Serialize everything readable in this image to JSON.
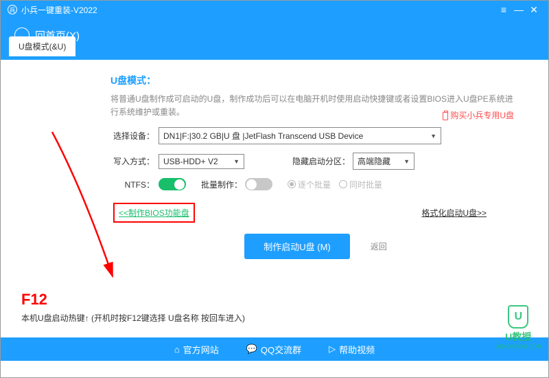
{
  "titlebar": {
    "app_name": "小兵一键重装-V2022"
  },
  "subheader": {
    "back_label": "回首页(X)"
  },
  "tab": {
    "label": "U盘模式(&U)"
  },
  "main": {
    "section_title": "U盘模式：",
    "description": "将普通U盘制作成可启动的U盘，制作成功后可以在电脑开机时使用启动快捷键或者设置BIOS进入U盘PE系统进行系统维护或重装。",
    "buy_link": "购买小兵专用U盘",
    "device_label": "选择设备：",
    "device_value": "DN1|F:|30.2 GB|U 盘 |JetFlash Transcend USB Device",
    "write_label": "写入方式：",
    "write_value": "USB-HDD+ V2",
    "hide_label": "隐藏启动分区：",
    "hide_value": "高端隐藏",
    "ntfs_label": "NTFS：",
    "batch_label": "批量制作：",
    "radio_each": "逐个批量",
    "radio_same": "同时批量",
    "bios_link": "<<制作BIOS功能盘",
    "format_link": "格式化启动U盘>>",
    "primary_button": "制作启动U盘 (M)",
    "back_text": "返回",
    "f12_label": "F12",
    "hotkey_text": "本机U盘启动热键↑ (开机时按F12键选择 U盘名称 按回车进入)"
  },
  "footer": {
    "site": "官方网站",
    "qq": "QQ交流群",
    "video": "帮助视频"
  },
  "watermark": {
    "brand": "U教授",
    "url": "UJIAOSHOU.COM"
  }
}
